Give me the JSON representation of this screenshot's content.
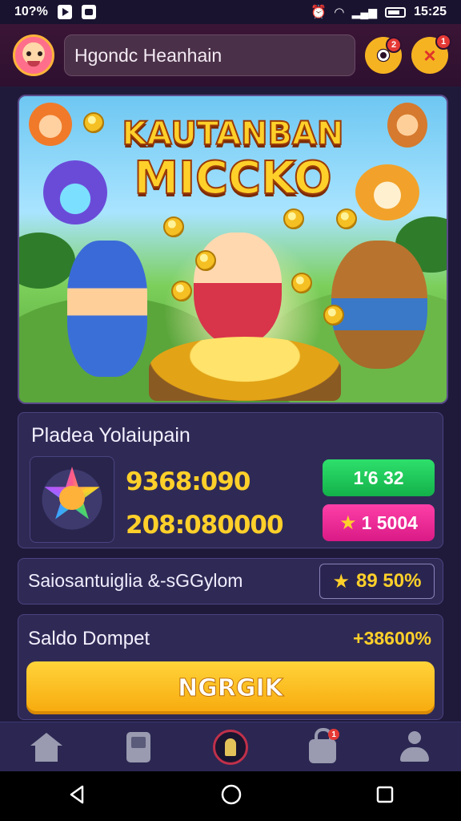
{
  "status_bar": {
    "left_text": "10?%",
    "time": "15:25"
  },
  "header": {
    "search_text": "Hgondc Heanhain"
  },
  "banner": {
    "title_line1": "KAUTANBAN",
    "title_line2": "MICCKO"
  },
  "panel_balance": {
    "title": "Pladea Yolaiupain",
    "amount_primary": "9368:090",
    "amount_secondary": "208:080000",
    "pill_green_label": "1′6 32",
    "pill_pink_label": "1 5004"
  },
  "panel_reward": {
    "text": "Saiosantuiglia &-sGGylom",
    "value": "89 50%"
  },
  "panel_wallet": {
    "label": "Saldo Dompet",
    "value": "+38600%",
    "button_label": "NGRGIK"
  },
  "badges": {
    "settings_count": "2",
    "close_count": "1",
    "lock_tab_count": "1"
  },
  "colors": {
    "accent_gold": "#ffd02a",
    "header_bg": "#3b1535",
    "panel_bg": "#2f2a55",
    "green_pill": "#1fc85a",
    "pink_pill": "#ff2f9a"
  },
  "icons": [
    "avatar",
    "settings-gear-icon",
    "close-icon",
    "home-icon",
    "phone-icon",
    "center-game-icon",
    "lock-icon",
    "user-icon",
    "back-icon",
    "home-circle-icon",
    "recent-apps-icon"
  ]
}
